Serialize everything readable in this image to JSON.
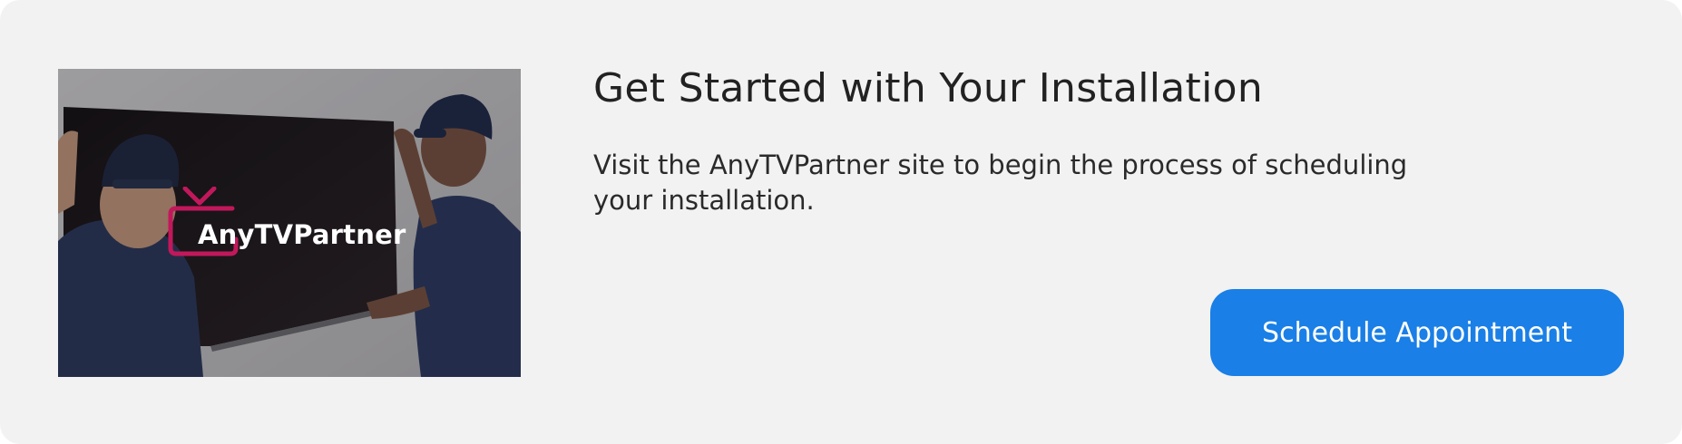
{
  "colors": {
    "card_background": "#f2f2f2",
    "button_background": "#1a7fe6",
    "button_text": "#ffffff",
    "brand_accent": "#c2185b",
    "title_text": "#222222"
  },
  "hero": {
    "alt": "Two installers mounting a TV on a wall",
    "brand_icon": "tv-icon",
    "brand_name": "AnyTVPartner"
  },
  "content": {
    "title": "Get Started with Your Installation",
    "description": "Visit the AnyTVPartner site to begin the process of scheduling your installation."
  },
  "cta": {
    "label": "Schedule Appointment"
  }
}
